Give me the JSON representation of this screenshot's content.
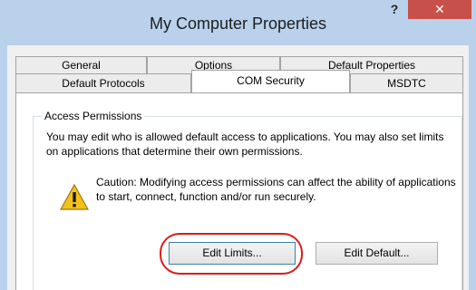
{
  "window": {
    "title": "My Computer Properties",
    "help_label": "?",
    "close_label": "✕"
  },
  "tabs": {
    "row1": [
      "General",
      "Options",
      "Default Properties"
    ],
    "row2": [
      "Default Protocols",
      "COM Security",
      "MSDTC"
    ],
    "active": "COM Security"
  },
  "access_permissions": {
    "group_title": "Access Permissions",
    "description": "You may edit who is allowed default access to applications. You may also set limits on applications that determine their own permissions.",
    "caution": "Caution: Modifying access permissions can affect the ability of applications to start, connect, function and/or run securely.",
    "edit_limits_label": "Edit Limits...",
    "edit_default_label": "Edit Default..."
  },
  "colors": {
    "title_bar": "#b9d1ea",
    "close_button": "#c7504a",
    "highlight": "#d91b1b"
  },
  "icons": {
    "warning": "warning-icon",
    "close": "close-icon",
    "help": "help-icon"
  }
}
